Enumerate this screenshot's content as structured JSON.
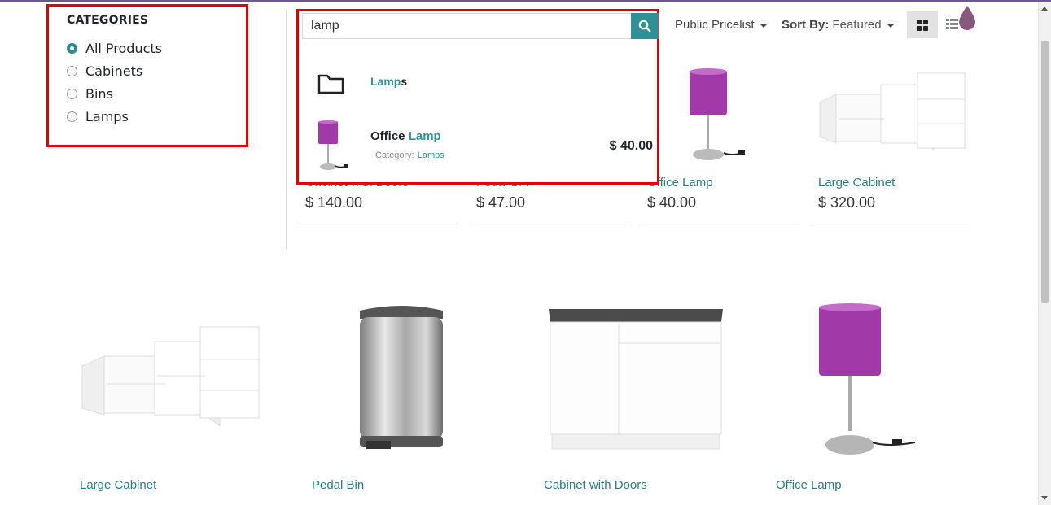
{
  "categories": {
    "title": "CATEGORIES",
    "items": [
      {
        "label": "All Products",
        "selected": true
      },
      {
        "label": "Cabinets",
        "selected": false
      },
      {
        "label": "Bins",
        "selected": false
      },
      {
        "label": "Lamps",
        "selected": false
      }
    ]
  },
  "search": {
    "value": "lamp",
    "results": {
      "category": {
        "match": "Lamp",
        "rest": "s"
      },
      "product": {
        "prefix": "Office ",
        "match": "Lamp",
        "category_label": "Category:",
        "category": "Lamps",
        "price": "$ 40.00"
      }
    }
  },
  "toolbar": {
    "pricelist": "Public Pricelist",
    "sort_label": "Sort By:",
    "sort_value": "Featured"
  },
  "top_row": [
    {
      "name": "Cabinet with Doors",
      "price": "$ 140.00"
    },
    {
      "name": "Pedal Bin",
      "price": "$ 47.00"
    },
    {
      "name": "Office Lamp",
      "price": "$ 40.00"
    },
    {
      "name": "Large Cabinet",
      "price": "$ 320.00"
    }
  ],
  "bottom_row": [
    {
      "name": "Large Cabinet"
    },
    {
      "name": "Pedal Bin"
    },
    {
      "name": "Cabinet with Doors"
    },
    {
      "name": "Office Lamp"
    }
  ],
  "colors": {
    "accent": "#2e9196",
    "highlight_box": "#e30000",
    "lamp_shade": "#a13aa8"
  }
}
